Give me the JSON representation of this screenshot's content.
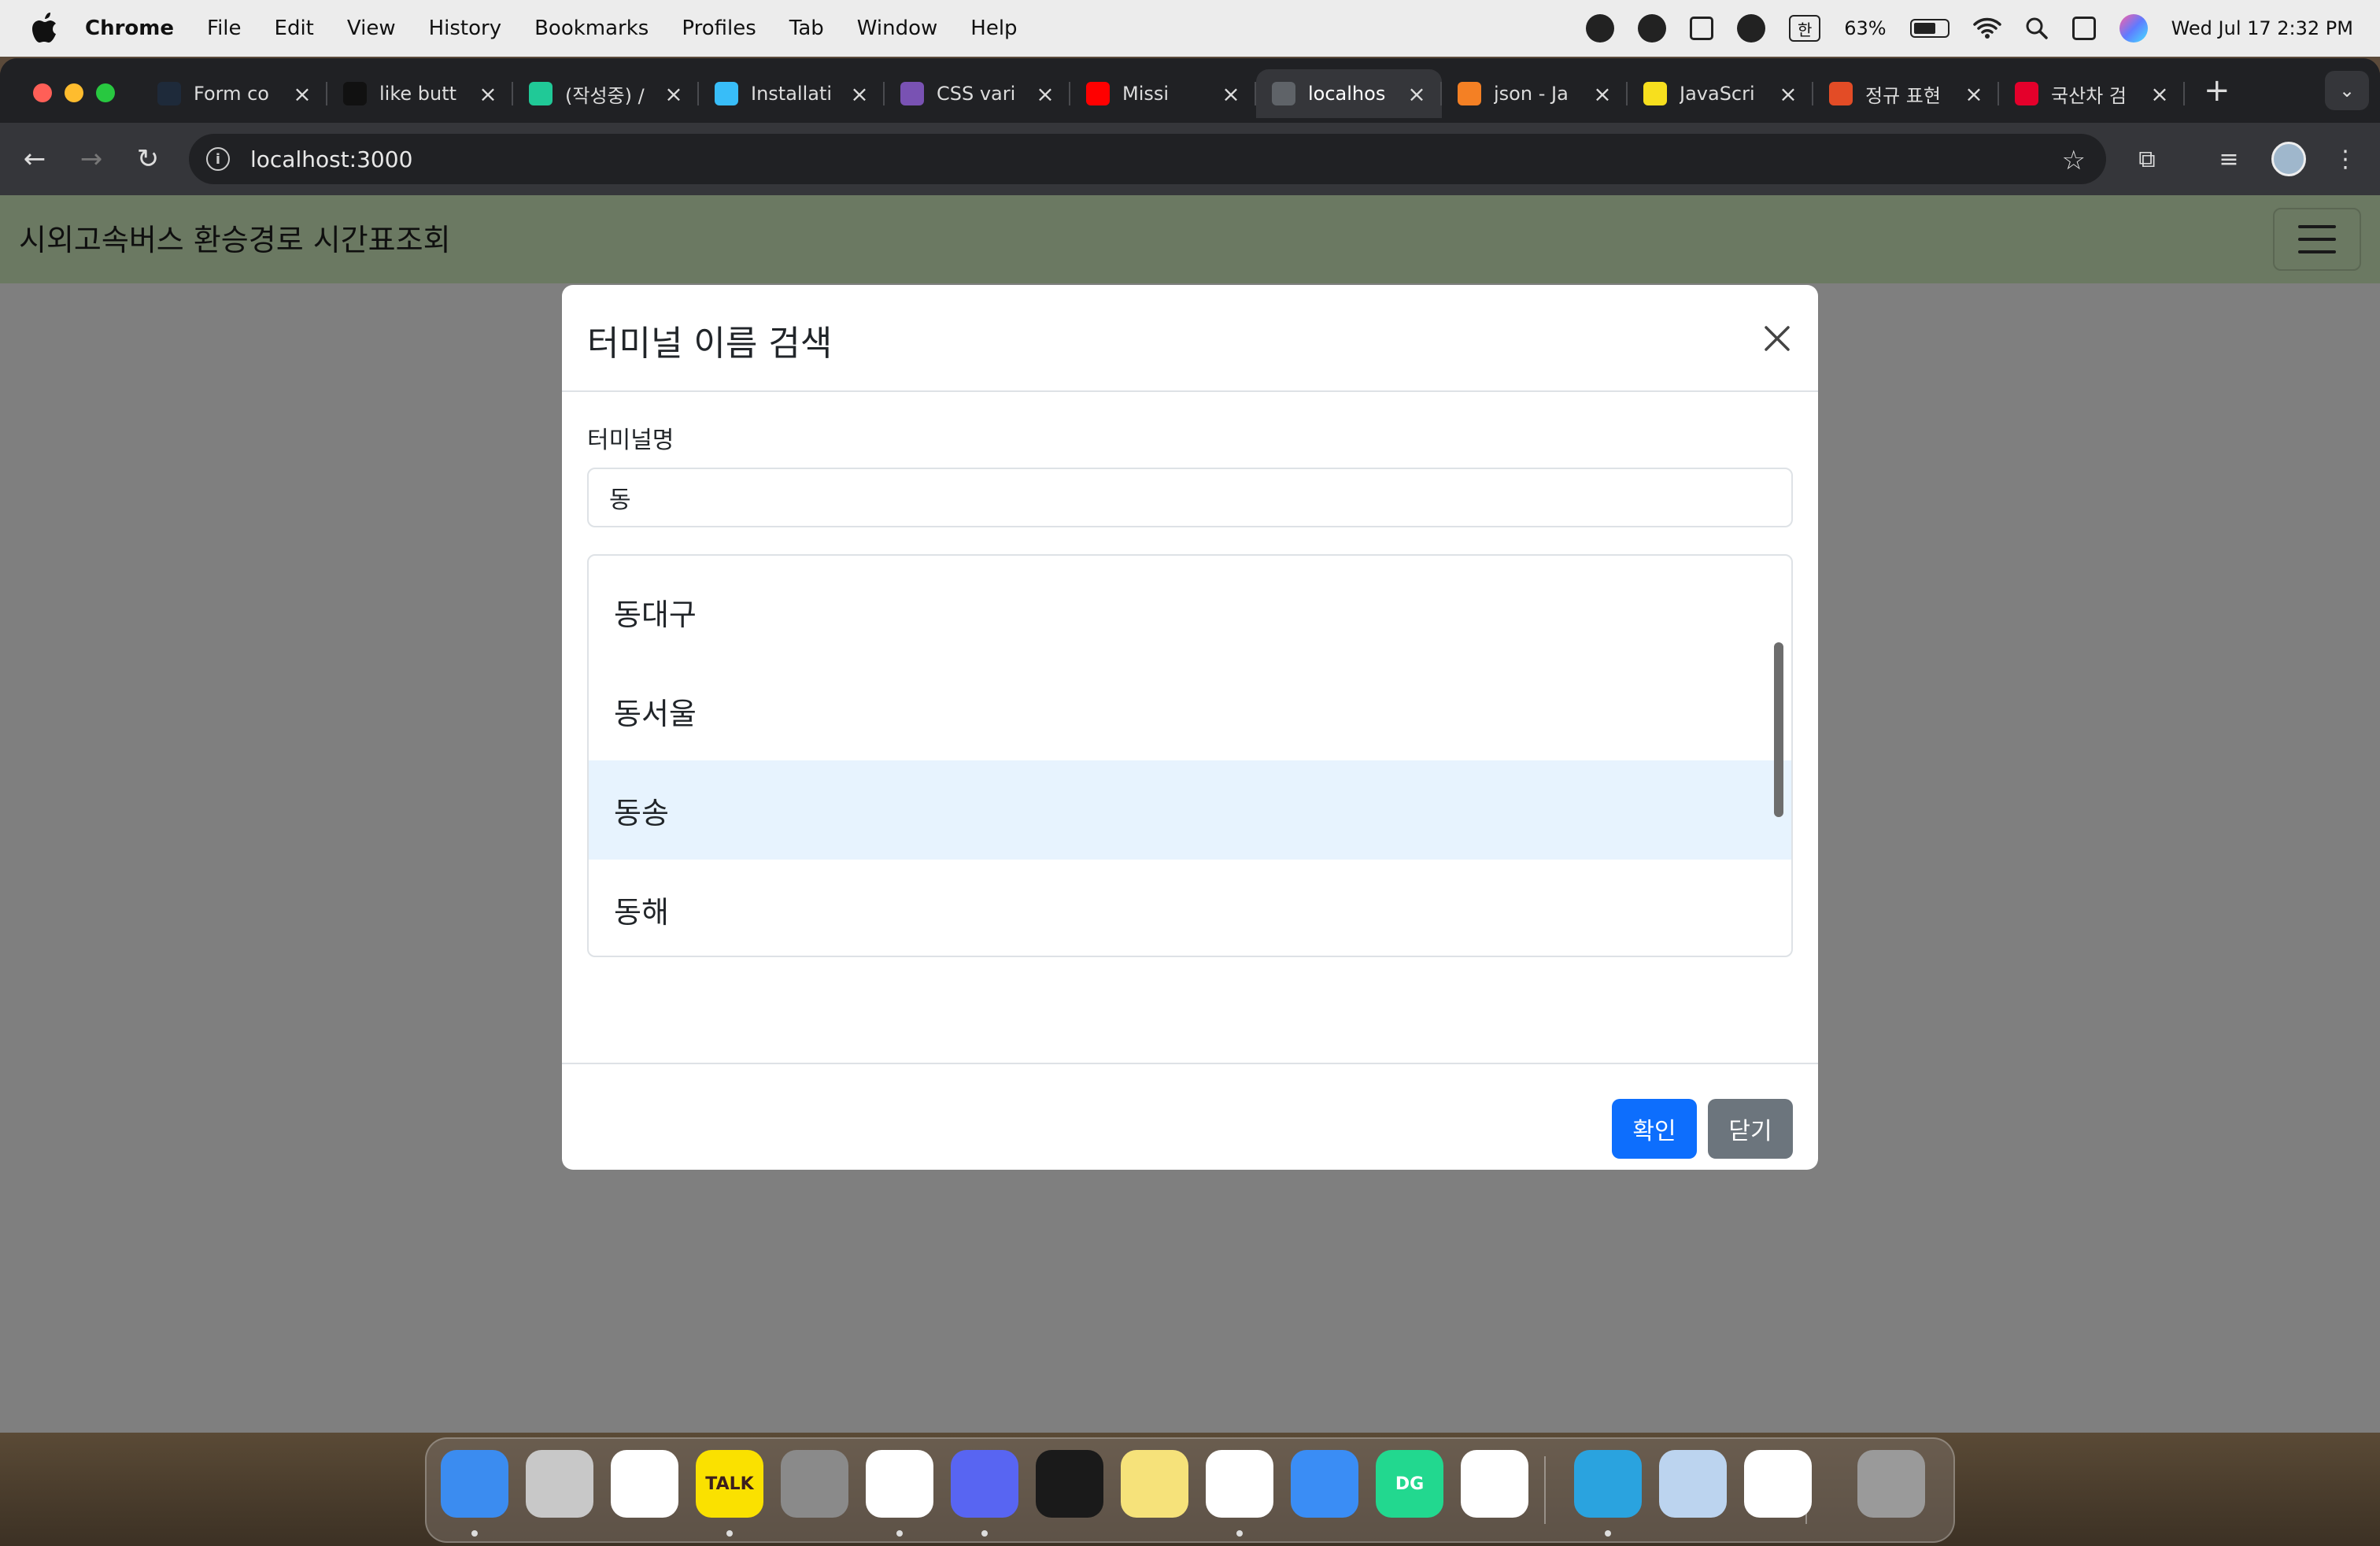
{
  "menubar": {
    "app_name": "Chrome",
    "items": [
      "File",
      "Edit",
      "View",
      "History",
      "Bookmarks",
      "Profiles",
      "Tab",
      "Window",
      "Help"
    ],
    "battery_percent": "63%",
    "input_source": "한",
    "datetime": "Wed Jul 17  2:32 PM"
  },
  "browser": {
    "tabs": [
      {
        "title": "Form co",
        "favicon": "react-icon",
        "color": "#1e2a3a"
      },
      {
        "title": "like butt",
        "favicon": "codesandbox-icon",
        "color": "#111111"
      },
      {
        "title": "(작성중) /",
        "favicon": "velog-icon",
        "color": "#20c997"
      },
      {
        "title": "Installati",
        "favicon": "tailwind-icon",
        "color": "#38bdf8"
      },
      {
        "title": "CSS vari",
        "favicon": "bootstrap-icon",
        "color": "#7952b3"
      },
      {
        "title": "Missi",
        "favicon": "youtube-icon",
        "color": "#ff0000"
      },
      {
        "title": "localhos",
        "favicon": "globe-icon",
        "color": "#5f6368"
      },
      {
        "title": "json - Ja",
        "favicon": "stackoverflow-icon",
        "color": "#f48024"
      },
      {
        "title": "JavaScri",
        "favicon": "javascript-icon",
        "color": "#f7df1e"
      },
      {
        "title": "정규 표현",
        "favicon": "regex-icon",
        "color": "#e34c26"
      },
      {
        "title": "국산차 검",
        "favicon": "encar-icon",
        "color": "#e4002b"
      }
    ],
    "active_tab_index": 6,
    "url": "localhost:3000"
  },
  "page": {
    "brand": "시외고속버스 환승경로 시간표조회",
    "brand_bar_color": "#d6f2c4"
  },
  "modal": {
    "title": "터미널 이름 검색",
    "field_label": "터미널명",
    "search_value": "동",
    "results": [
      "동대구",
      "동서울",
      "동송",
      "동해"
    ],
    "highlighted_result": "동송",
    "confirm_label": "확인",
    "close_label": "닫기",
    "primary_color": "#0d6efd",
    "secondary_color": "#6c757d"
  },
  "dock": {
    "apps": [
      {
        "name": "finder-icon",
        "color": "#3b8cf0",
        "label": ""
      },
      {
        "name": "launchpad-icon",
        "color": "#c8c8c8",
        "label": ""
      },
      {
        "name": "calendar-icon",
        "color": "#ffffff",
        "label": ""
      },
      {
        "name": "kakaotalk-icon",
        "color": "#fae100",
        "label": "TALK"
      },
      {
        "name": "system-settings-icon",
        "color": "#8a8a8a",
        "label": ""
      },
      {
        "name": "chrome-icon",
        "color": "#ffffff",
        "label": ""
      },
      {
        "name": "discord-icon",
        "color": "#5865f2",
        "label": ""
      },
      {
        "name": "terminal-icon",
        "color": "#1a1a1a",
        "label": ""
      },
      {
        "name": "notes-icon",
        "color": "#f6e27a",
        "label": ""
      },
      {
        "name": "vscode-icon",
        "color": "#ffffff",
        "label": ""
      },
      {
        "name": "xcode-icon",
        "color": "#3a8df5",
        "label": ""
      },
      {
        "name": "datagrip-icon",
        "color": "#22d88f",
        "label": "DG"
      },
      {
        "name": "edge-icon",
        "color": "#ffffff",
        "label": ""
      },
      {
        "name": "telegram-icon",
        "color": "#2aa3df",
        "label": ""
      },
      {
        "name": "preview-icon",
        "color": "#bcd4ef",
        "label": ""
      },
      {
        "name": "clock-icon",
        "color": "#ffffff",
        "label": ""
      },
      {
        "name": "trash-icon",
        "color": "#9a9a9a",
        "label": ""
      }
    ]
  }
}
